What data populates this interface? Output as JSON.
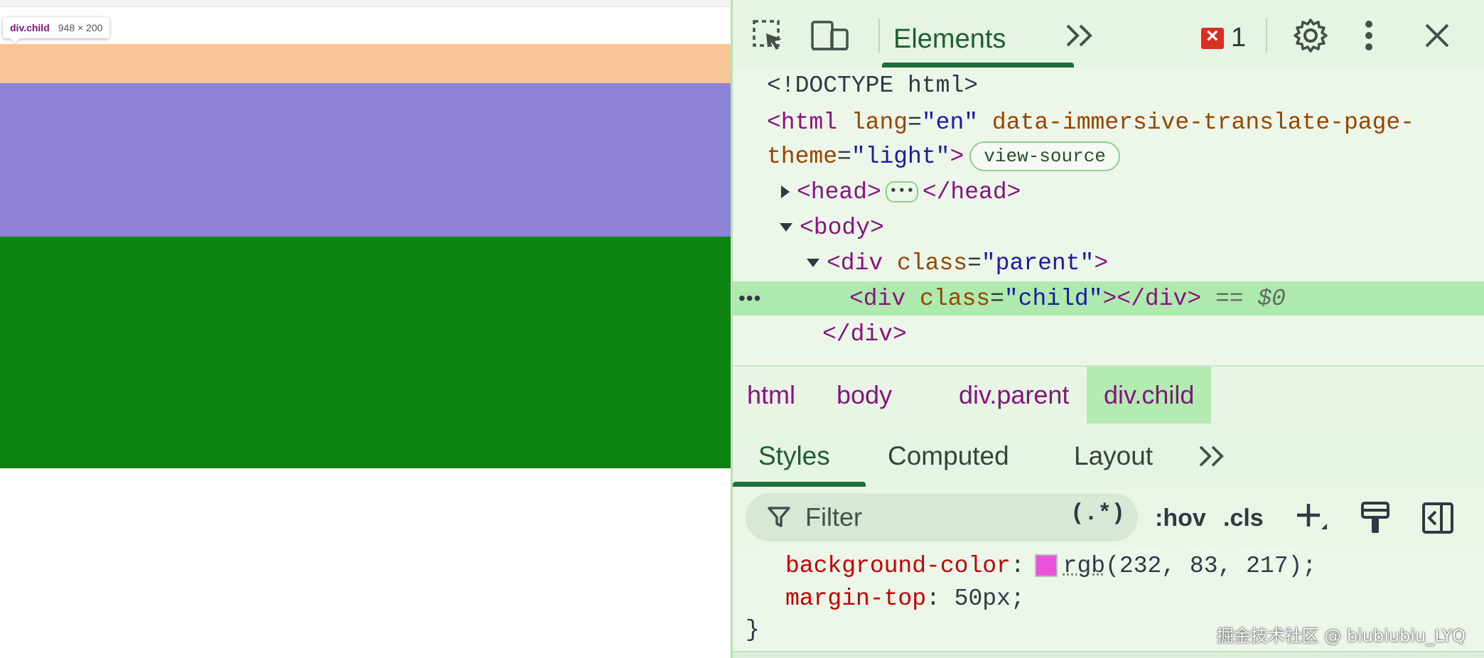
{
  "preview": {
    "tooltip": {
      "element": "div.child",
      "size": "948 × 200"
    },
    "bands": [
      {
        "name": "band-peach",
        "color": "#f6c699"
      },
      {
        "name": "band-purple",
        "color": "#8f82d9"
      },
      {
        "name": "band-green",
        "color": "#0d8412"
      }
    ]
  },
  "devtools": {
    "toolbar": {
      "elements_tab": "Elements",
      "more_tabs": "»",
      "error_count": "1",
      "icons": [
        "inspect-icon",
        "device-toolbar-icon",
        "chevron-double-right-icon",
        "error-icon",
        "gear-icon",
        "kebab-menu-icon",
        "close-icon"
      ]
    },
    "dom": {
      "doctype": "<!DOCTYPE html>",
      "html_open_tag": "<html",
      "lang_attr": "lang",
      "lang_value": "\"en\"",
      "immersive_attr": "data-immersive-translate-page-",
      "theme_attr": "theme",
      "theme_value": "\"light\"",
      "close_bracket": ">",
      "view_source": "view-source",
      "head_open": "<head>",
      "head_ellipsis": "•••",
      "head_close": "</head>",
      "body_open": "<body>",
      "div_open": "<div",
      "class_attr": "class",
      "parent_value": "\"parent\"",
      "child_value": "\"child\"",
      "div_close": "></div>",
      "equals_marker": "== $0",
      "div_end": "</div>",
      "gutter": "•••",
      "equals": "=",
      "gt": ">"
    },
    "breadcrumbs": [
      "html",
      "body",
      "div.parent",
      "div.child"
    ],
    "styles_tabs": [
      "Styles",
      "Computed",
      "Layout"
    ],
    "styles_more": "»",
    "filter": {
      "placeholder": "Filter",
      "regex": "(.*)",
      "hov": ":hov",
      "cls": ".cls",
      "icons": [
        "filter-icon",
        "new-rule-plus-icon",
        "paint-brush-icon",
        "toggle-sidebar-icon"
      ]
    },
    "css": {
      "prop1": "background-color",
      "colon": ":",
      "val1_func": "rgb",
      "val1_args": "(232, 83, 217);",
      "swatch_color": "#e853d9",
      "prop2": "margin-top",
      "val2": "50px;",
      "close_brace": "}"
    }
  },
  "watermark": "掘金技术社区 @ biubiubiu_LYQ"
}
